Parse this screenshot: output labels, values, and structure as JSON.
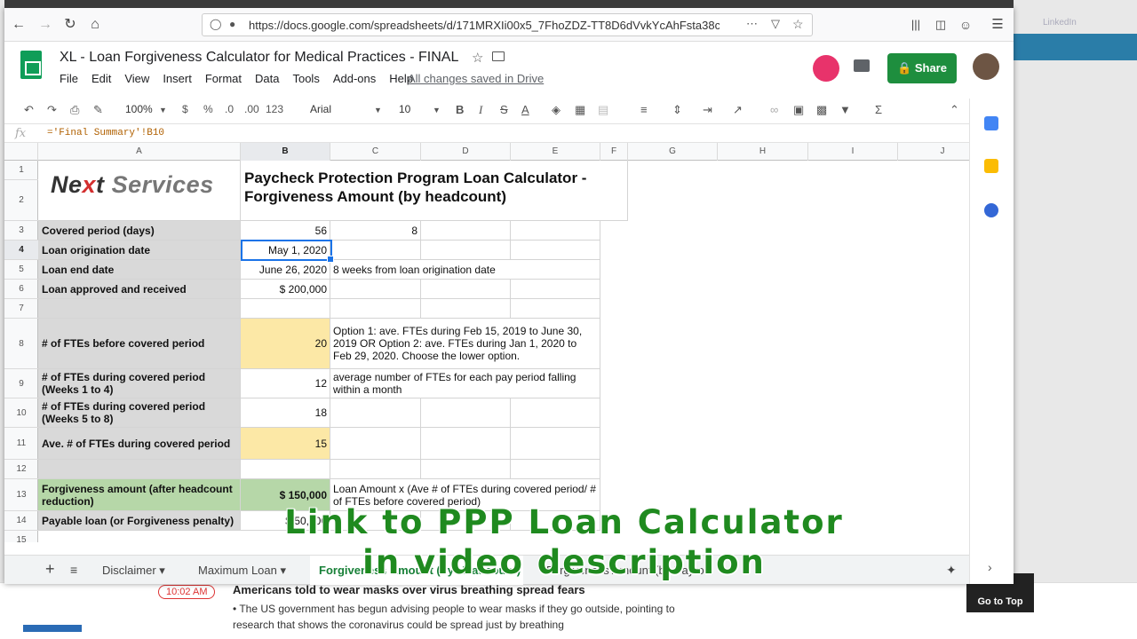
{
  "browser": {
    "url": "https://docs.google.com/spreadsheets/d/171MRXIi00x5_7FhoZDZ-TT8D6dVvkYcAhFsta38cR",
    "bg_tab_label": "LinkedIn"
  },
  "doc": {
    "title": "XL - Loan Forgiveness Calculator for Medical Practices - FINAL",
    "saved_status": "All changes saved in Drive",
    "share_label": "Share",
    "menu": [
      "File",
      "Edit",
      "View",
      "Insert",
      "Format",
      "Data",
      "Tools",
      "Add-ons",
      "Help"
    ]
  },
  "toolbar": {
    "zoom": "100%",
    "currency": "$",
    "percent": "%",
    "dec_minus": ".0",
    "dec_plus": ".00",
    "format_more": "123",
    "font": "Arial",
    "font_size": "10"
  },
  "formula_bar": {
    "fx": "fx",
    "formula": "='Final Summary'!B10"
  },
  "columns": [
    "A",
    "B",
    "C",
    "D",
    "E",
    "F",
    "G",
    "H",
    "I",
    "J"
  ],
  "rows": [
    "1",
    "2",
    "3",
    "4",
    "5",
    "6",
    "7",
    "8",
    "9",
    "10",
    "11",
    "12",
    "13",
    "14",
    "15"
  ],
  "sheet": {
    "logo": {
      "part1": "Ne",
      "x": "x",
      "part2": "t",
      "part3": "Services"
    },
    "title_line1": "Paycheck Protection Program Loan Calculator -",
    "title_line2": "Forgiveness Amount (by headcount)",
    "r3": {
      "label": "Covered period (days)",
      "b": "56",
      "c": "8"
    },
    "r4": {
      "label": "Loan origination date",
      "b": "May 1, 2020"
    },
    "r5": {
      "label": "Loan end date",
      "b": "June 26, 2020",
      "note": "8 weeks from loan origination date"
    },
    "r6": {
      "label": "Loan approved and received",
      "b": "$ 200,000"
    },
    "r8": {
      "label": "# of FTEs before covered period",
      "b": "20",
      "note": "Option 1: ave. FTEs during Feb 15, 2019 to June 30, 2019 OR Option 2: ave. FTEs during Jan 1, 2020 to Feb 29, 2020. Choose the lower option."
    },
    "r9": {
      "label": "# of FTEs during covered period (Weeks 1 to 4)",
      "b": "12",
      "note": "average number of FTEs for each pay period falling within a month"
    },
    "r10": {
      "label": "# of FTEs during covered period (Weeks 5 to 8)",
      "b": "18"
    },
    "r11": {
      "label": "Ave. # of FTEs during covered period",
      "b": "15"
    },
    "r13": {
      "label": "Forgiveness amount (after headcount reduction)",
      "b": "$ 150,000",
      "note": "Loan Amount x (Ave # of FTEs during covered period/ # of FTEs before covered period)"
    },
    "r14": {
      "label": "Payable loan (or Forgiveness penalty)",
      "b": "$ 50,000"
    }
  },
  "tabs": [
    "Disclaimer",
    "Maximum Loan",
    "Forgiveness Amount (by Headcount)",
    "Forgiveness Amount (by Payroll)"
  ],
  "caption": {
    "line1": "Link to PPP Loan Calculator",
    "line2": "in video description"
  },
  "background": {
    "time": "10:02 AM",
    "headline": "Americans told to wear masks over virus breathing spread fears",
    "bullet": "The US government has begun advising people to wear masks if they go outside, pointing to research that shows the coronavirus could be spread just by breathing",
    "goto": "Go to Top"
  }
}
